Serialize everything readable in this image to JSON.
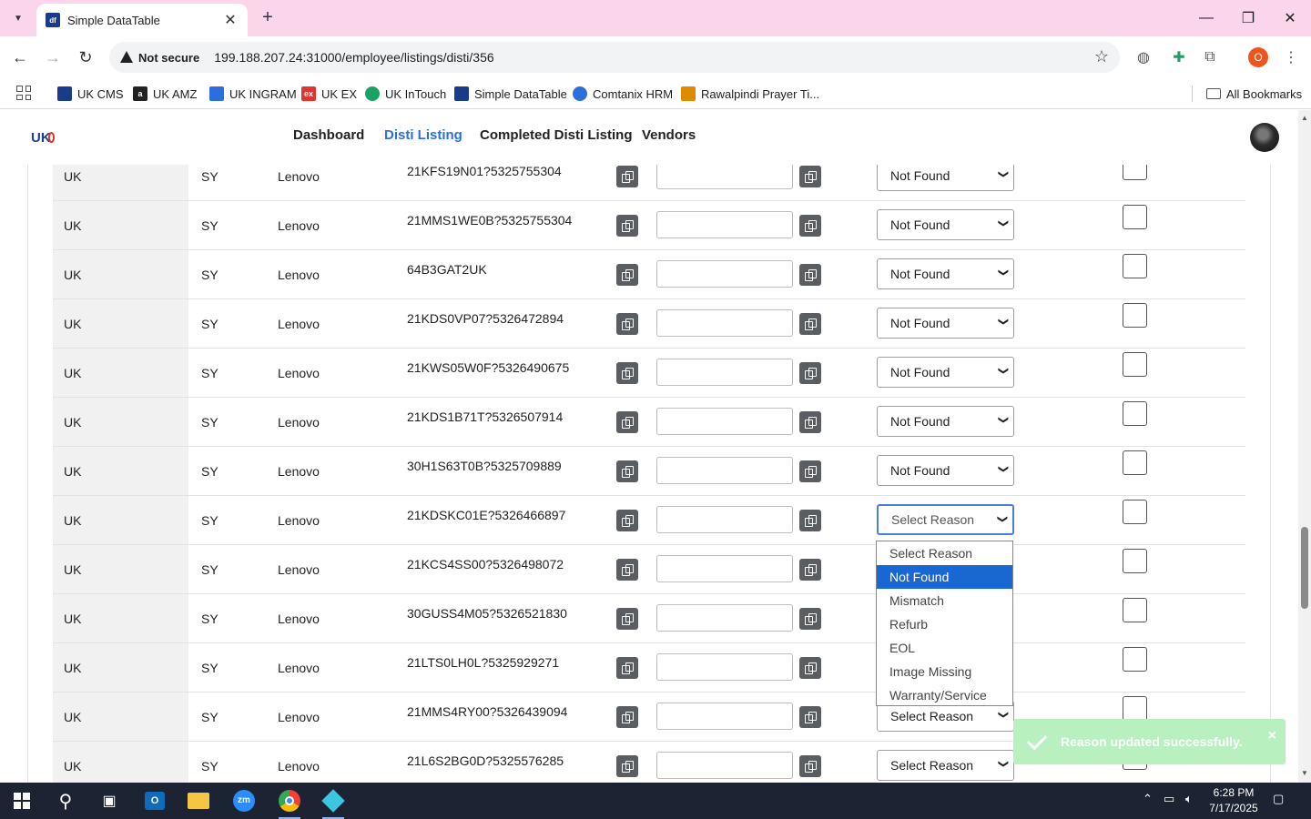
{
  "browser": {
    "tab_title": "Simple DataTable",
    "tab_favicon": "df",
    "address": {
      "security_label": "Not secure",
      "url": "199.188.207.24:31000/employee/listings/disti/356"
    },
    "profile_initial": "O",
    "bookmarks": [
      {
        "label": "UK CMS",
        "icon": "uk-cms-icon",
        "color": "#1a3a8a"
      },
      {
        "label": "UK AMZ",
        "icon": "amazon-icon",
        "color": "#222222"
      },
      {
        "label": "UK INGRAM",
        "icon": "ingram-icon",
        "color": "#2a6fdb"
      },
      {
        "label": "UK EX",
        "icon": "ex-icon",
        "color": "#e0342d"
      },
      {
        "label": "UK InTouch",
        "icon": "intouch-icon",
        "color": "#1aa260"
      },
      {
        "label": "Simple DataTable",
        "icon": "datatable-icon",
        "color": "#1a3a8a"
      },
      {
        "label": "Comtanix HRM",
        "icon": "comtanix-icon",
        "color": "#2a6fdb"
      },
      {
        "label": "Rawalpindi Prayer Ti...",
        "icon": "prayer-icon",
        "color": "#e08a00"
      }
    ],
    "all_bookmarks": "All Bookmarks"
  },
  "app": {
    "logo_text": "UK",
    "nav": [
      "Dashboard",
      "Disti Listing",
      "Completed Disti Listing",
      "Vendors"
    ],
    "active_nav": "Disti Listing"
  },
  "rows": [
    {
      "country": "UK",
      "code": "SY",
      "brand": "Lenovo",
      "part": "21KFS19N01?5325755304",
      "reason": "Not Found"
    },
    {
      "country": "UK",
      "code": "SY",
      "brand": "Lenovo",
      "part": "21MMS1WE0B?5325755304",
      "reason": "Not Found"
    },
    {
      "country": "UK",
      "code": "SY",
      "brand": "Lenovo",
      "part": "64B3GAT2UK",
      "reason": "Not Found"
    },
    {
      "country": "UK",
      "code": "SY",
      "brand": "Lenovo",
      "part": "21KDS0VP07?5326472894",
      "reason": "Not Found"
    },
    {
      "country": "UK",
      "code": "SY",
      "brand": "Lenovo",
      "part": "21KWS05W0F?5326490675",
      "reason": "Not Found"
    },
    {
      "country": "UK",
      "code": "SY",
      "brand": "Lenovo",
      "part": "21KDS1B71T?5326507914",
      "reason": "Not Found"
    },
    {
      "country": "UK",
      "code": "SY",
      "brand": "Lenovo",
      "part": "30H1S63T0B?5325709889",
      "reason": "Not Found"
    },
    {
      "country": "UK",
      "code": "SY",
      "brand": "Lenovo",
      "part": "21KDSKC01E?5326466897",
      "reason": "Select Reason"
    },
    {
      "country": "UK",
      "code": "SY",
      "brand": "Lenovo",
      "part": "21KCS4SS00?5326498072",
      "reason": ""
    },
    {
      "country": "UK",
      "code": "SY",
      "brand": "Lenovo",
      "part": "30GUSS4M05?5326521830",
      "reason": ""
    },
    {
      "country": "UK",
      "code": "SY",
      "brand": "Lenovo",
      "part": "21LTS0LH0L?5325929271",
      "reason": ""
    },
    {
      "country": "UK",
      "code": "SY",
      "brand": "Lenovo",
      "part": "21MMS4RY00?5326439094",
      "reason": "Select Reason"
    },
    {
      "country": "UK",
      "code": "SY",
      "brand": "Lenovo",
      "part": "21L6S2BG0D?5325576285",
      "reason": "Select Reason"
    }
  ],
  "reason_dropdown": {
    "options": [
      "Select Reason",
      "Not Found",
      "Mismatch",
      "Refurb",
      "EOL",
      "Image Missing",
      "Warranty/Service"
    ],
    "highlighted": "Not Found"
  },
  "toast": {
    "message": "Reason updated successfully.",
    "close": "×"
  },
  "taskbar": {
    "time": "6:28 PM",
    "date": "7/17/2025"
  },
  "colors": {
    "tabbar_bg": "#fbd6ea",
    "active_nav": "#2a6fdb",
    "copy_button": "#5a5e63",
    "toast_bg": "#b9f0c0",
    "dropdown_highlight": "#1967d2"
  }
}
